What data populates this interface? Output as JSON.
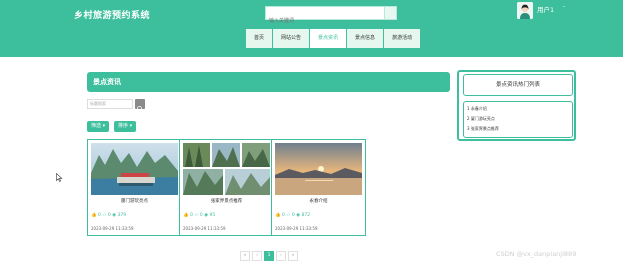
{
  "app": {
    "title": "乡村旅游预约系统"
  },
  "search": {
    "placeholder": "输入关键词"
  },
  "user": {
    "name": "用户1",
    "caret": "-"
  },
  "nav": [
    {
      "label": "首页"
    },
    {
      "label": "网站公告"
    },
    {
      "label": "景点资讯",
      "active": true
    },
    {
      "label": "景点信息"
    },
    {
      "label": "旅游活动"
    }
  ],
  "main": {
    "title": "景点资讯",
    "keyword_placeholder": "标题搜索",
    "filter_label": "筛选",
    "sort_label": "排序"
  },
  "cards": [
    {
      "title": "厦门游玩亮点",
      "likes": "0",
      "favs": "0",
      "views": "379",
      "date": "2023-09-29 11:33:59"
    },
    {
      "title": "张家界景点推荐",
      "likes": "0",
      "favs": "0",
      "views": "95",
      "date": "2023-09-29 11:33:59"
    },
    {
      "title": "永春介绍",
      "likes": "0",
      "favs": "0",
      "views": "872",
      "date": "2023-09-29 11:33:59"
    }
  ],
  "sidebar": {
    "title": "景点资讯热门列表",
    "items": [
      "1 永春介绍",
      "2 厦门游玩亮点",
      "3 张家界景点推荐"
    ]
  },
  "pagination": {
    "prev2": "«",
    "prev": "‹",
    "current": "1",
    "next": "›",
    "next2": "»"
  },
  "watermark": "CSDN @vx_danpianji889",
  "colors": {
    "accent": "#3dbf9d"
  }
}
